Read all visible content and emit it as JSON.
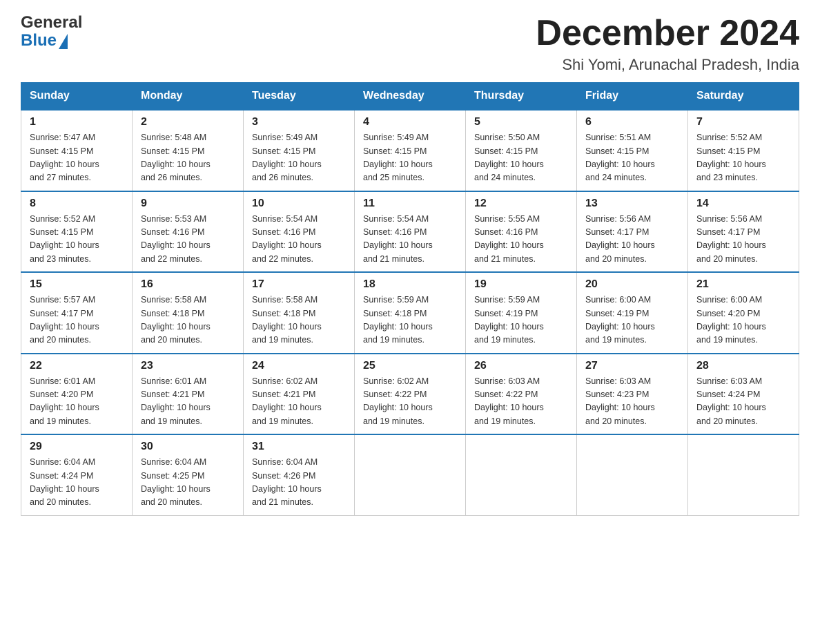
{
  "header": {
    "logo_general": "General",
    "logo_blue": "Blue",
    "title": "December 2024",
    "subtitle": "Shi Yomi, Arunachal Pradesh, India"
  },
  "weekdays": [
    "Sunday",
    "Monday",
    "Tuesday",
    "Wednesday",
    "Thursday",
    "Friday",
    "Saturday"
  ],
  "weeks": [
    [
      {
        "day": "1",
        "sunrise": "5:47 AM",
        "sunset": "4:15 PM",
        "daylight": "10 hours and 27 minutes."
      },
      {
        "day": "2",
        "sunrise": "5:48 AM",
        "sunset": "4:15 PM",
        "daylight": "10 hours and 26 minutes."
      },
      {
        "day": "3",
        "sunrise": "5:49 AM",
        "sunset": "4:15 PM",
        "daylight": "10 hours and 26 minutes."
      },
      {
        "day": "4",
        "sunrise": "5:49 AM",
        "sunset": "4:15 PM",
        "daylight": "10 hours and 25 minutes."
      },
      {
        "day": "5",
        "sunrise": "5:50 AM",
        "sunset": "4:15 PM",
        "daylight": "10 hours and 24 minutes."
      },
      {
        "day": "6",
        "sunrise": "5:51 AM",
        "sunset": "4:15 PM",
        "daylight": "10 hours and 24 minutes."
      },
      {
        "day": "7",
        "sunrise": "5:52 AM",
        "sunset": "4:15 PM",
        "daylight": "10 hours and 23 minutes."
      }
    ],
    [
      {
        "day": "8",
        "sunrise": "5:52 AM",
        "sunset": "4:15 PM",
        "daylight": "10 hours and 23 minutes."
      },
      {
        "day": "9",
        "sunrise": "5:53 AM",
        "sunset": "4:16 PM",
        "daylight": "10 hours and 22 minutes."
      },
      {
        "day": "10",
        "sunrise": "5:54 AM",
        "sunset": "4:16 PM",
        "daylight": "10 hours and 22 minutes."
      },
      {
        "day": "11",
        "sunrise": "5:54 AM",
        "sunset": "4:16 PM",
        "daylight": "10 hours and 21 minutes."
      },
      {
        "day": "12",
        "sunrise": "5:55 AM",
        "sunset": "4:16 PM",
        "daylight": "10 hours and 21 minutes."
      },
      {
        "day": "13",
        "sunrise": "5:56 AM",
        "sunset": "4:17 PM",
        "daylight": "10 hours and 20 minutes."
      },
      {
        "day": "14",
        "sunrise": "5:56 AM",
        "sunset": "4:17 PM",
        "daylight": "10 hours and 20 minutes."
      }
    ],
    [
      {
        "day": "15",
        "sunrise": "5:57 AM",
        "sunset": "4:17 PM",
        "daylight": "10 hours and 20 minutes."
      },
      {
        "day": "16",
        "sunrise": "5:58 AM",
        "sunset": "4:18 PM",
        "daylight": "10 hours and 20 minutes."
      },
      {
        "day": "17",
        "sunrise": "5:58 AM",
        "sunset": "4:18 PM",
        "daylight": "10 hours and 19 minutes."
      },
      {
        "day": "18",
        "sunrise": "5:59 AM",
        "sunset": "4:18 PM",
        "daylight": "10 hours and 19 minutes."
      },
      {
        "day": "19",
        "sunrise": "5:59 AM",
        "sunset": "4:19 PM",
        "daylight": "10 hours and 19 minutes."
      },
      {
        "day": "20",
        "sunrise": "6:00 AM",
        "sunset": "4:19 PM",
        "daylight": "10 hours and 19 minutes."
      },
      {
        "day": "21",
        "sunrise": "6:00 AM",
        "sunset": "4:20 PM",
        "daylight": "10 hours and 19 minutes."
      }
    ],
    [
      {
        "day": "22",
        "sunrise": "6:01 AM",
        "sunset": "4:20 PM",
        "daylight": "10 hours and 19 minutes."
      },
      {
        "day": "23",
        "sunrise": "6:01 AM",
        "sunset": "4:21 PM",
        "daylight": "10 hours and 19 minutes."
      },
      {
        "day": "24",
        "sunrise": "6:02 AM",
        "sunset": "4:21 PM",
        "daylight": "10 hours and 19 minutes."
      },
      {
        "day": "25",
        "sunrise": "6:02 AM",
        "sunset": "4:22 PM",
        "daylight": "10 hours and 19 minutes."
      },
      {
        "day": "26",
        "sunrise": "6:03 AM",
        "sunset": "4:22 PM",
        "daylight": "10 hours and 19 minutes."
      },
      {
        "day": "27",
        "sunrise": "6:03 AM",
        "sunset": "4:23 PM",
        "daylight": "10 hours and 20 minutes."
      },
      {
        "day": "28",
        "sunrise": "6:03 AM",
        "sunset": "4:24 PM",
        "daylight": "10 hours and 20 minutes."
      }
    ],
    [
      {
        "day": "29",
        "sunrise": "6:04 AM",
        "sunset": "4:24 PM",
        "daylight": "10 hours and 20 minutes."
      },
      {
        "day": "30",
        "sunrise": "6:04 AM",
        "sunset": "4:25 PM",
        "daylight": "10 hours and 20 minutes."
      },
      {
        "day": "31",
        "sunrise": "6:04 AM",
        "sunset": "4:26 PM",
        "daylight": "10 hours and 21 minutes."
      },
      null,
      null,
      null,
      null
    ]
  ],
  "labels": {
    "sunrise": "Sunrise:",
    "sunset": "Sunset:",
    "daylight": "Daylight:"
  }
}
